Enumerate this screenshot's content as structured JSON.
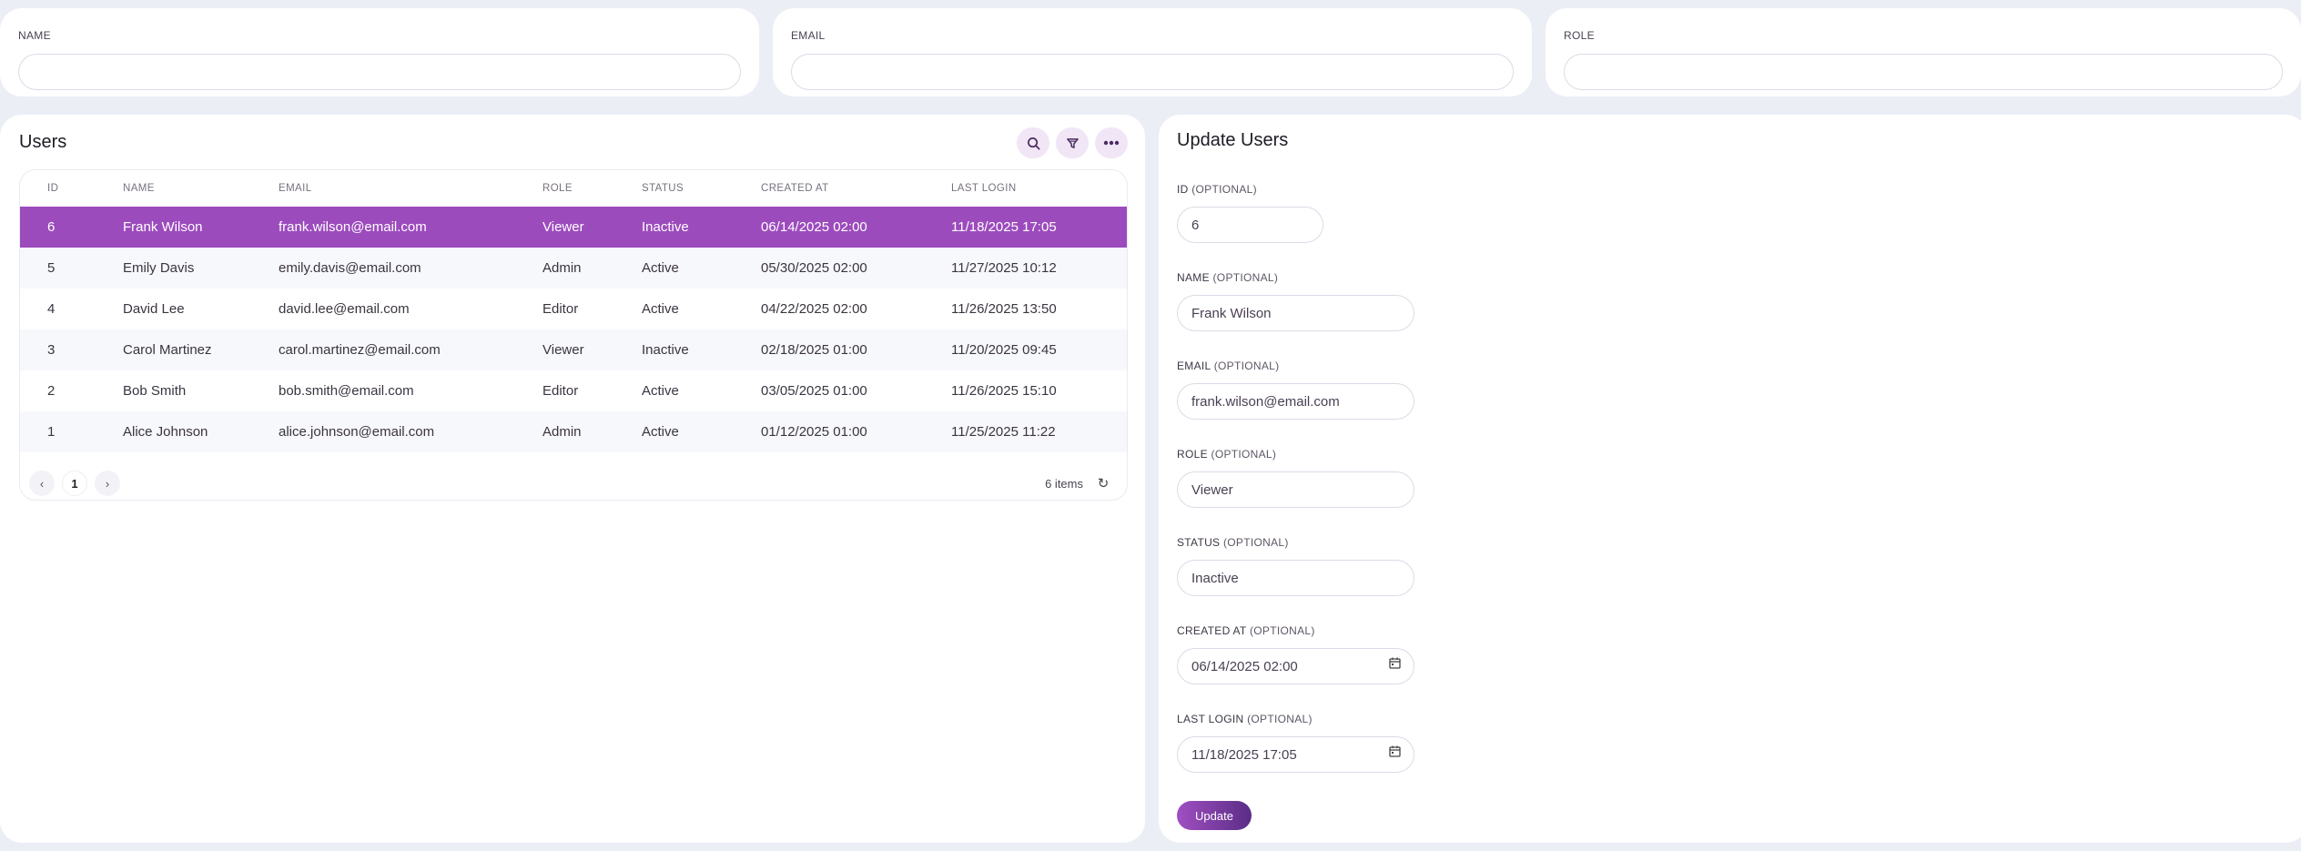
{
  "filters": [
    {
      "label": "NAME",
      "value": ""
    },
    {
      "label": "EMAIL",
      "value": ""
    },
    {
      "label": "ROLE",
      "value": ""
    }
  ],
  "users": {
    "title": "Users",
    "columns": [
      "ID",
      "NAME",
      "EMAIL",
      "ROLE",
      "STATUS",
      "CREATED AT",
      "LAST LOGIN"
    ],
    "rows": [
      {
        "id": "6",
        "name": "Frank Wilson",
        "email": "frank.wilson@email.com",
        "role": "Viewer",
        "status": "Inactive",
        "created": "06/14/2025 02:00",
        "login": "11/18/2025 17:05"
      },
      {
        "id": "5",
        "name": "Emily Davis",
        "email": "emily.davis@email.com",
        "role": "Admin",
        "status": "Active",
        "created": "05/30/2025 02:00",
        "login": "11/27/2025 10:12"
      },
      {
        "id": "4",
        "name": "David Lee",
        "email": "david.lee@email.com",
        "role": "Editor",
        "status": "Active",
        "created": "04/22/2025 02:00",
        "login": "11/26/2025 13:50"
      },
      {
        "id": "3",
        "name": "Carol Martinez",
        "email": "carol.martinez@email.com",
        "role": "Viewer",
        "status": "Inactive",
        "created": "02/18/2025 01:00",
        "login": "11/20/2025 09:45"
      },
      {
        "id": "2",
        "name": "Bob Smith",
        "email": "bob.smith@email.com",
        "role": "Editor",
        "status": "Active",
        "created": "03/05/2025 01:00",
        "login": "11/26/2025 15:10"
      },
      {
        "id": "1",
        "name": "Alice Johnson",
        "email": "alice.johnson@email.com",
        "role": "Admin",
        "status": "Active",
        "created": "01/12/2025 01:00",
        "login": "11/25/2025 11:22"
      }
    ],
    "pagination": {
      "prev": "‹",
      "page": "1",
      "next": "›",
      "items": "6 items",
      "refresh": "↻"
    },
    "icons": {
      "search": "search-icon",
      "filter": "filter-icon",
      "more": "more-icon"
    }
  },
  "update": {
    "title": "Update Users",
    "fields": [
      {
        "label": "ID",
        "optional": "(OPTIONAL)",
        "value": "6"
      },
      {
        "label": "NAME",
        "optional": "(OPTIONAL)",
        "value": "Frank Wilson"
      },
      {
        "label": "EMAIL",
        "optional": "(OPTIONAL)",
        "value": "frank.wilson@email.com"
      },
      {
        "label": "ROLE",
        "optional": "(OPTIONAL)",
        "value": "Viewer"
      },
      {
        "label": "STATUS",
        "optional": "(OPTIONAL)",
        "value": "Inactive"
      },
      {
        "label": "CREATED AT",
        "optional": "(OPTIONAL)",
        "value": "06/14/2025 02:00"
      },
      {
        "label": "LAST LOGIN",
        "optional": "(OPTIONAL)",
        "value": "11/18/2025 17:05"
      }
    ],
    "button": "Update"
  },
  "colors": {
    "accent": "#9c4bbd",
    "accent_dark": "#5a2d86",
    "background": "#eceef6"
  }
}
